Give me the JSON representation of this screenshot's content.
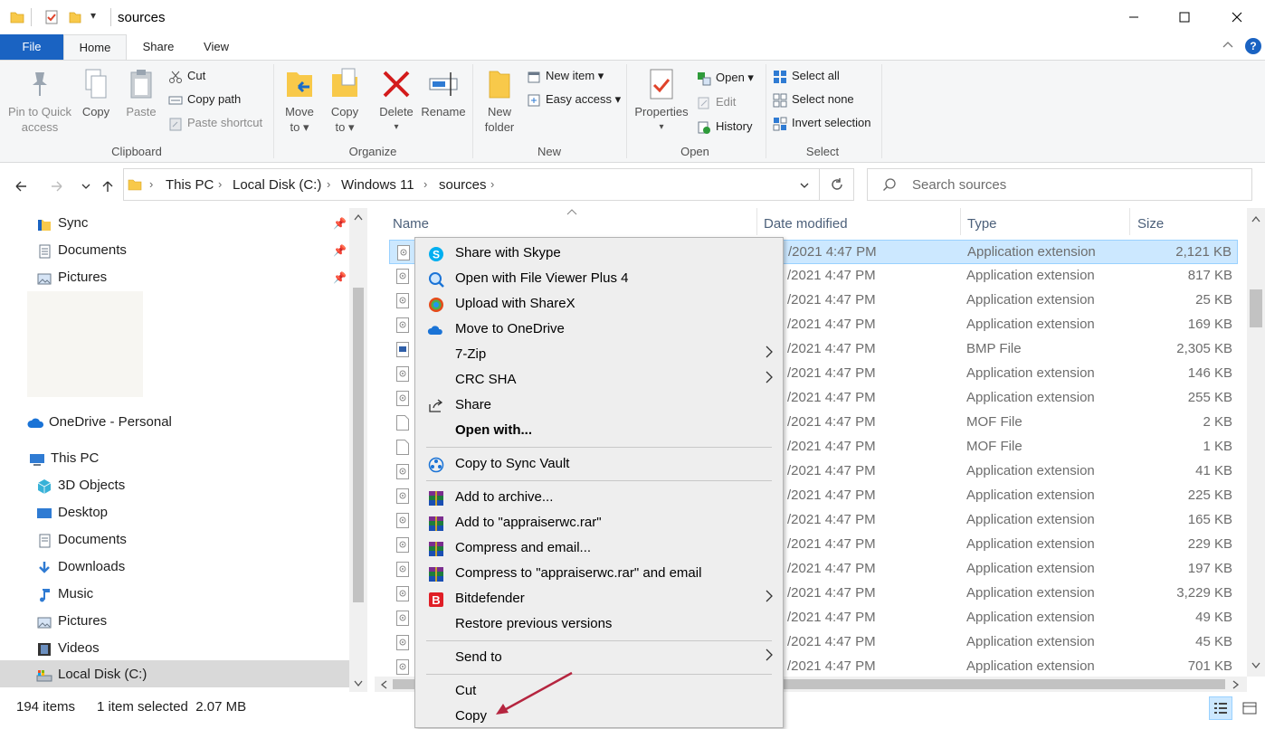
{
  "titlebar": {
    "title": "sources",
    "qat_dropdown": "▾"
  },
  "tabs": [
    {
      "label": "File"
    },
    {
      "label": "Home"
    },
    {
      "label": "Share"
    },
    {
      "label": "View"
    }
  ],
  "ribbon": {
    "clipboard": {
      "label": "Clipboard",
      "pin_line1": "Pin to Quick",
      "pin_line2": "access",
      "copy": "Copy",
      "paste": "Paste",
      "cut": "Cut",
      "copy_path": "Copy path",
      "paste_shortcut": "Paste shortcut"
    },
    "organize": {
      "label": "Organize",
      "move_line1": "Move",
      "move_line2": "to ▾",
      "copy_line1": "Copy",
      "copy_line2": "to ▾",
      "delete": "Delete",
      "delete_arrow": "▾",
      "rename": "Rename"
    },
    "new": {
      "label": "New",
      "folder_line1": "New",
      "folder_line2": "folder",
      "new_item": "New item ▾",
      "easy_access": "Easy access ▾"
    },
    "open": {
      "label": "Open",
      "properties": "Properties",
      "properties_arrow": "▾",
      "open": "Open ▾",
      "edit": "Edit",
      "history": "History"
    },
    "select": {
      "label": "Select",
      "select_all": "Select all",
      "select_none": "Select none",
      "invert_selection": "Invert selection"
    }
  },
  "address": {
    "crumbs": [
      "This PC",
      "Local Disk (C:)",
      "Windows 11",
      "sources"
    ],
    "search_placeholder": "Search sources"
  },
  "nav": {
    "quick_access": [
      {
        "label": "Sync"
      },
      {
        "label": "Documents"
      },
      {
        "label": "Pictures"
      }
    ],
    "onedrive": "OneDrive - Personal",
    "this_pc": "This PC",
    "pc_items": [
      {
        "label": "3D Objects"
      },
      {
        "label": "Desktop"
      },
      {
        "label": "Documents"
      },
      {
        "label": "Downloads"
      },
      {
        "label": "Music"
      },
      {
        "label": "Pictures"
      },
      {
        "label": "Videos"
      },
      {
        "label": "Local Disk (C:)"
      }
    ]
  },
  "columns": {
    "name": "Name",
    "date": "Date modified",
    "type": "Type",
    "size": "Size"
  },
  "files": [
    {
      "date": "/2021 4:47 PM",
      "type": "Application extension",
      "size": "2,121 KB"
    },
    {
      "date": "/2021 4:47 PM",
      "type": "Application extension",
      "size": "817 KB"
    },
    {
      "date": "/2021 4:47 PM",
      "type": "Application extension",
      "size": "25 KB"
    },
    {
      "date": "/2021 4:47 PM",
      "type": "Application extension",
      "size": "169 KB"
    },
    {
      "date": "/2021 4:47 PM",
      "type": "BMP File",
      "size": "2,305 KB"
    },
    {
      "date": "/2021 4:47 PM",
      "type": "Application extension",
      "size": "146 KB"
    },
    {
      "date": "/2021 4:47 PM",
      "type": "Application extension",
      "size": "255 KB"
    },
    {
      "date": "/2021 4:47 PM",
      "type": "MOF File",
      "size": "2 KB"
    },
    {
      "date": "/2021 4:47 PM",
      "type": "MOF File",
      "size": "1 KB"
    },
    {
      "date": "/2021 4:47 PM",
      "type": "Application extension",
      "size": "41 KB"
    },
    {
      "date": "/2021 4:47 PM",
      "type": "Application extension",
      "size": "225 KB"
    },
    {
      "date": "/2021 4:47 PM",
      "type": "Application extension",
      "size": "165 KB"
    },
    {
      "date": "/2021 4:47 PM",
      "type": "Application extension",
      "size": "229 KB"
    },
    {
      "date": "/2021 4:47 PM",
      "type": "Application extension",
      "size": "197 KB"
    },
    {
      "date": "/2021 4:47 PM",
      "type": "Application extension",
      "size": "3,229 KB"
    },
    {
      "date": "/2021 4:47 PM",
      "type": "Application extension",
      "size": "49 KB"
    },
    {
      "date": "/2021 4:47 PM",
      "type": "Application extension",
      "size": "45 KB"
    },
    {
      "date": "/2021 4:47 PM",
      "type": "Application extension",
      "size": "701 KB"
    }
  ],
  "context_menu": {
    "share_skype": "Share with Skype",
    "file_viewer": "Open with File Viewer Plus 4",
    "sharex": "Upload with ShareX",
    "onedrive": "Move to OneDrive",
    "zip": "7-Zip",
    "crc": "CRC SHA",
    "share": "Share",
    "open_with": "Open with...",
    "sync_vault": "Copy to Sync Vault",
    "add_archive": "Add to archive...",
    "add_rar": "Add to \"appraiserwc.rar\"",
    "compress_email": "Compress and email...",
    "compress_rar_email": "Compress to \"appraiserwc.rar\" and email",
    "bitdefender": "Bitdefender",
    "restore": "Restore previous versions",
    "send_to": "Send to",
    "cut": "Cut",
    "copy": "Copy"
  },
  "status": {
    "items": "194 items",
    "selected": "1 item selected  2.07 MB"
  },
  "colors": {
    "accent": "#1a63c2",
    "selection": "#cce8ff",
    "annotation_arrow": "#b5253f"
  }
}
